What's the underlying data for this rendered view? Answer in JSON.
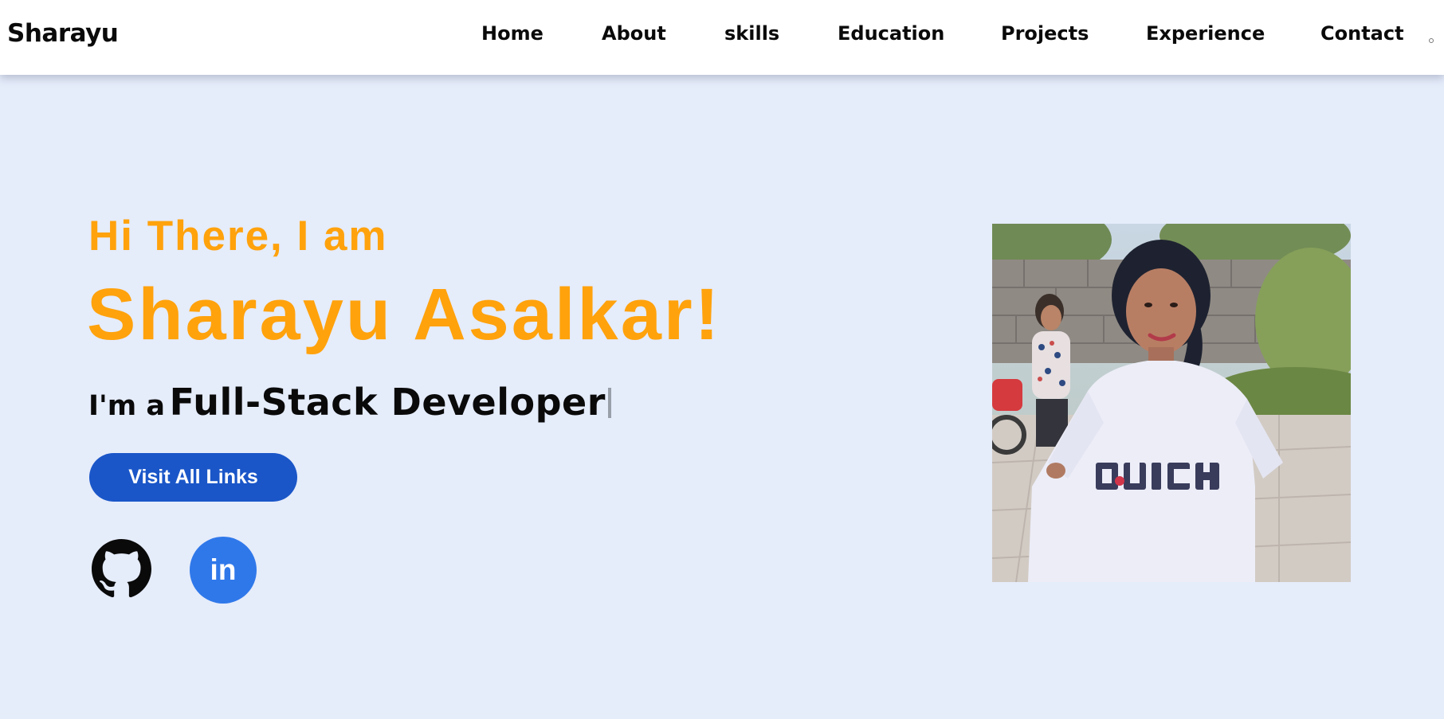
{
  "navbar": {
    "brand": "Sharayu",
    "links": [
      "Home",
      "About",
      "skills",
      "Education",
      "Projects",
      "Experience",
      "Contact"
    ]
  },
  "hero": {
    "greeting": "Hi There, I am",
    "name": "Sharayu Asalkar!",
    "role_prefix": "I'm a",
    "role_text": "Full-Stack Developer",
    "cta_label": "Visit All Links",
    "social": {
      "github_icon": "github-icon",
      "linkedin_label": "in"
    }
  },
  "colors": {
    "background": "#e5ecfa",
    "accent": "#ffa20c",
    "button": "#1a56c8",
    "linkedin": "#2f78ea"
  }
}
